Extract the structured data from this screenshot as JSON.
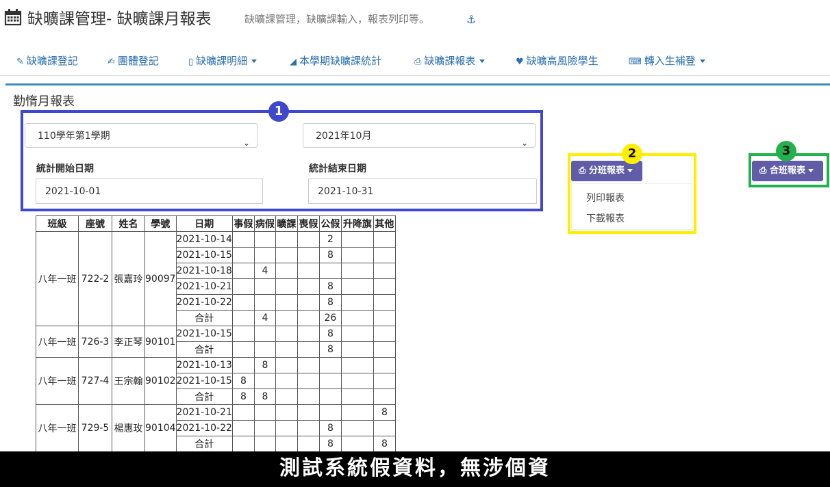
{
  "header": {
    "title": "缺曠課管理- 缺曠課月報表",
    "subtitle": "缺曠課管理，缺曠課輸入，報表列印等。",
    "anchor_icon": "anchor-icon"
  },
  "nav": {
    "items": [
      {
        "label": "缺曠課登記",
        "icon": "pencil-icon",
        "dropdown": false
      },
      {
        "label": "團體登記",
        "icon": "edit-icon",
        "dropdown": false
      },
      {
        "label": "缺曠課明細",
        "icon": "file-icon",
        "dropdown": true
      },
      {
        "label": "本學期缺曠課統計",
        "icon": "area-chart-icon",
        "dropdown": false
      },
      {
        "label": "缺曠課報表",
        "icon": "print-icon",
        "dropdown": true
      },
      {
        "label": "缺曠高風險學生",
        "icon": "heartbeat-icon",
        "dropdown": false
      },
      {
        "label": "轉入生補登",
        "icon": "keyboard-icon",
        "dropdown": true
      }
    ]
  },
  "panel": {
    "title": "勤惰月報表"
  },
  "filters": {
    "term": "110學年第1學期",
    "month": "2021年10月",
    "start_label": "統計開始日期",
    "end_label": "統計結束日期",
    "start_value": "2021-10-01",
    "end_value": "2021-10-31"
  },
  "badges": {
    "b1": "1",
    "b2": "2",
    "b3": "3"
  },
  "buttons": {
    "split_report": "分班報表",
    "merged_report": "合班報表",
    "dropdown": {
      "print": "列印報表",
      "download": "下載報表"
    }
  },
  "colors": {
    "box1": "#3f48cc",
    "box2": "#ffee00",
    "box3": "#22b14c",
    "button": "#605ca8",
    "link": "#2a6fb0"
  },
  "table": {
    "headers": [
      "班級",
      "座號",
      "姓名",
      "學號",
      "日期",
      "事假",
      "病假",
      "曠課",
      "喪假",
      "公假",
      "升降旗",
      "其他"
    ],
    "students": [
      {
        "class": "八年一班",
        "seat": "722-2",
        "name": "張嘉玲",
        "id": "90097",
        "rows": [
          {
            "date": "2021-10-14",
            "vals": [
              "",
              "",
              "",
              "",
              "2",
              "",
              ""
            ]
          },
          {
            "date": "2021-10-15",
            "vals": [
              "",
              "",
              "",
              "",
              "8",
              "",
              ""
            ]
          },
          {
            "date": "2021-10-18",
            "vals": [
              "",
              "4",
              "",
              "",
              "",
              "",
              ""
            ]
          },
          {
            "date": "2021-10-21",
            "vals": [
              "",
              "",
              "",
              "",
              "8",
              "",
              ""
            ]
          },
          {
            "date": "2021-10-22",
            "vals": [
              "",
              "",
              "",
              "",
              "8",
              "",
              ""
            ]
          },
          {
            "date": "合計",
            "vals": [
              "",
              "4",
              "",
              "",
              "26",
              "",
              ""
            ]
          }
        ]
      },
      {
        "class": "八年一班",
        "seat": "726-3",
        "name": "李正琴",
        "id": "90101",
        "rows": [
          {
            "date": "2021-10-15",
            "vals": [
              "",
              "",
              "",
              "",
              "8",
              "",
              ""
            ]
          },
          {
            "date": "合計",
            "vals": [
              "",
              "",
              "",
              "",
              "8",
              "",
              ""
            ]
          }
        ]
      },
      {
        "class": "八年一班",
        "seat": "727-4",
        "name": "王宗翰",
        "id": "90102",
        "rows": [
          {
            "date": "2021-10-13",
            "vals": [
              "",
              "8",
              "",
              "",
              "",
              "",
              ""
            ]
          },
          {
            "date": "2021-10-15",
            "vals": [
              "8",
              "",
              "",
              "",
              "",
              "",
              ""
            ]
          },
          {
            "date": "合計",
            "vals": [
              "8",
              "8",
              "",
              "",
              "",
              "",
              ""
            ]
          }
        ]
      },
      {
        "class": "八年一班",
        "seat": "729-5",
        "name": "楊惠玫",
        "id": "90104",
        "rows": [
          {
            "date": "2021-10-21",
            "vals": [
              "",
              "",
              "",
              "",
              "",
              "",
              "8"
            ]
          },
          {
            "date": "2021-10-22",
            "vals": [
              "",
              "",
              "",
              "",
              "8",
              "",
              ""
            ]
          },
          {
            "date": "合計",
            "vals": [
              "",
              "",
              "",
              "",
              "8",
              "",
              "8"
            ]
          }
        ]
      }
    ]
  },
  "footer": {
    "text": "測試系統假資料，無涉個資"
  }
}
